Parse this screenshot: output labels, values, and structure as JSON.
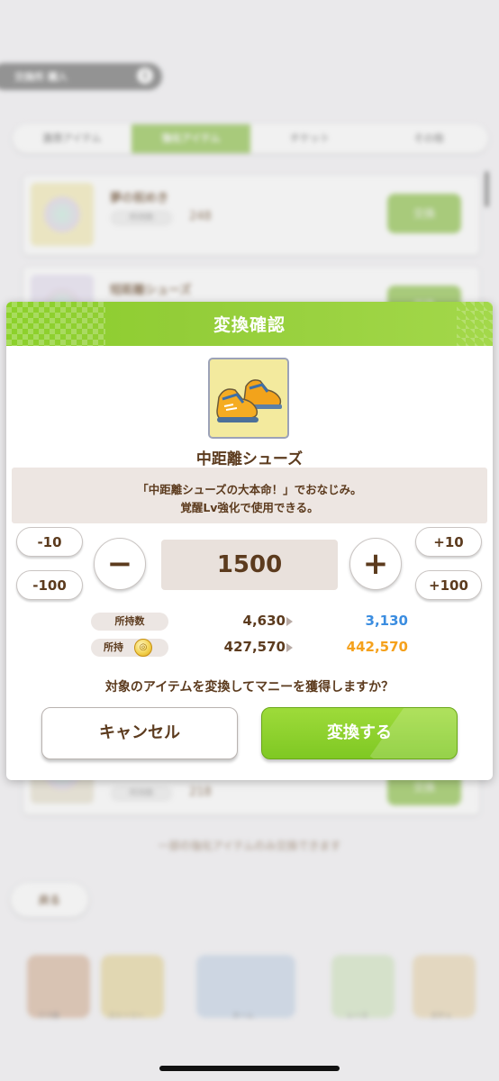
{
  "background": {
    "header": {
      "title": "交換所 購入",
      "info_icon": "info-icon"
    },
    "tabs": [
      {
        "label": "激昂アイテム",
        "active": false
      },
      {
        "label": "強化アイテム",
        "active": true
      },
      {
        "label": "チケット",
        "active": false
      },
      {
        "label": "その他",
        "active": false
      }
    ],
    "cards": [
      {
        "name": "夢の祝めき",
        "tag": "所持数",
        "count": "248",
        "button": "交換"
      },
      {
        "name": "短距離シューズ",
        "tag": "所持数",
        "count": "",
        "button": "交換"
      },
      {
        "name": "",
        "tag": "所持数",
        "count": "218",
        "button": "交換"
      }
    ],
    "note": "一部の強化アイテムのみ交換できます",
    "back_label": "戻る",
    "nav": [
      "ウマ娘",
      "ストーリー",
      "ホーム",
      "レース",
      "ガチャ"
    ]
  },
  "dialog": {
    "title": "変換確認",
    "item_name": "中距離シューズ",
    "description_line1": "「中距離シューズの大本命！」でおなじみ。",
    "description_line2": "覚醒Lv強化で使用できる。",
    "step_minus_10": "-10",
    "step_minus_100": "-100",
    "step_plus_10": "+10",
    "step_plus_100": "+100",
    "minus_symbol": "−",
    "plus_symbol": "+",
    "quantity": "1500",
    "owned_label": "所持数",
    "owned_current": "4,630",
    "owned_after": "3,130",
    "money_label": "所持",
    "money_current": "427,570",
    "money_after": "442,570",
    "question": "対象のアイテムを変換してマニーを獲得しますか？",
    "cancel_label": "キャンセル",
    "confirm_label": "変換する",
    "colors": {
      "header_green": "#8cd12a",
      "text_brown": "#5c3b1e",
      "owned_after_blue": "#3b8de0",
      "money_after_orange": "#f5a11c",
      "confirm_green": "#86cc28"
    }
  }
}
